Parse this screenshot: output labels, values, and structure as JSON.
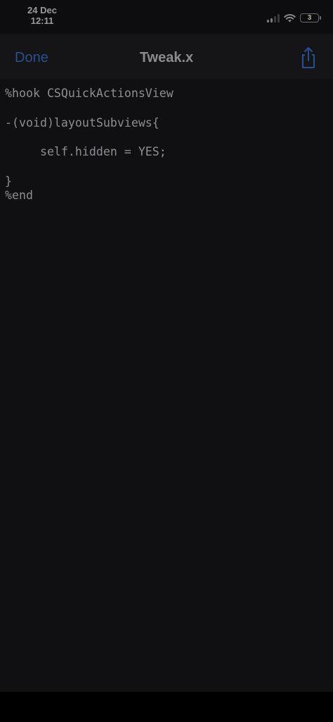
{
  "status_bar": {
    "date": "24 Dec",
    "time": "12:11",
    "signal_icon": "cellular-signal-icon",
    "wifi_icon": "wifi-icon",
    "battery_level": "3"
  },
  "nav": {
    "done_label": "Done",
    "title": "Tweak.x",
    "share_icon": "share-icon",
    "accent_color": "#2a4f8f"
  },
  "editor": {
    "lines": [
      "%hook CSQuickActionsView",
      "-(void)layoutSubviews{",
      "     self.hidden = YES;",
      "}",
      "%end"
    ]
  }
}
